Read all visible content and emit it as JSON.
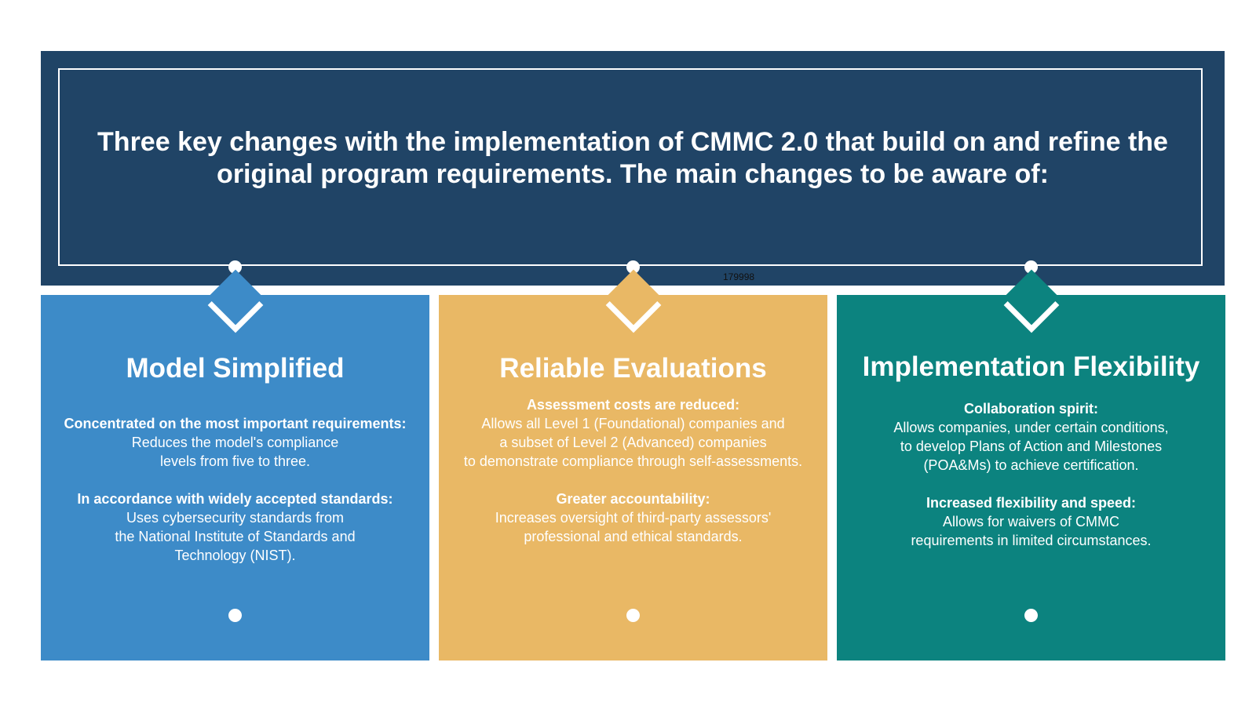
{
  "header": {
    "title": "Three key changes with the implementation of CMMC 2.0 that build on and refine the original program requirements. The main changes to be aware of:",
    "code": "179998"
  },
  "colors": {
    "header_bg": "#204466",
    "card_blue": "#3d8bc8",
    "card_gold": "#e9b865",
    "card_teal": "#0c837f"
  },
  "cards": [
    {
      "title": "Model Simplified",
      "sections": [
        {
          "heading": "Concentrated on the most important requirements:",
          "lines": [
            "Reduces the model's compliance",
            "levels from five to three."
          ]
        },
        {
          "heading": "In accordance with widely accepted standards:",
          "lines": [
            "Uses cybersecurity standards from",
            "the National Institute of Standards and",
            "Technology (NIST)."
          ]
        }
      ]
    },
    {
      "title": "Reliable Evaluations",
      "sections": [
        {
          "heading": "Assessment costs are reduced:",
          "lines": [
            "Allows all Level 1 (Foundational) companies and",
            "a subset of Level 2 (Advanced) companies",
            "to demonstrate compliance through self-assessments."
          ]
        },
        {
          "heading": "Greater accountability:",
          "lines": [
            "Increases oversight of third-party assessors'",
            "professional and ethical standards."
          ]
        }
      ]
    },
    {
      "title": "Implementation Flexibility",
      "sections": [
        {
          "heading": "Collaboration spirit:",
          "lines": [
            "Allows companies, under certain conditions,",
            "to develop Plans of Action and Milestones",
            "(POA&Ms) to achieve certification."
          ]
        },
        {
          "heading": "Increased flexibility and speed:",
          "lines": [
            "Allows for waivers of CMMC",
            "requirements in limited circumstances."
          ]
        }
      ]
    }
  ]
}
